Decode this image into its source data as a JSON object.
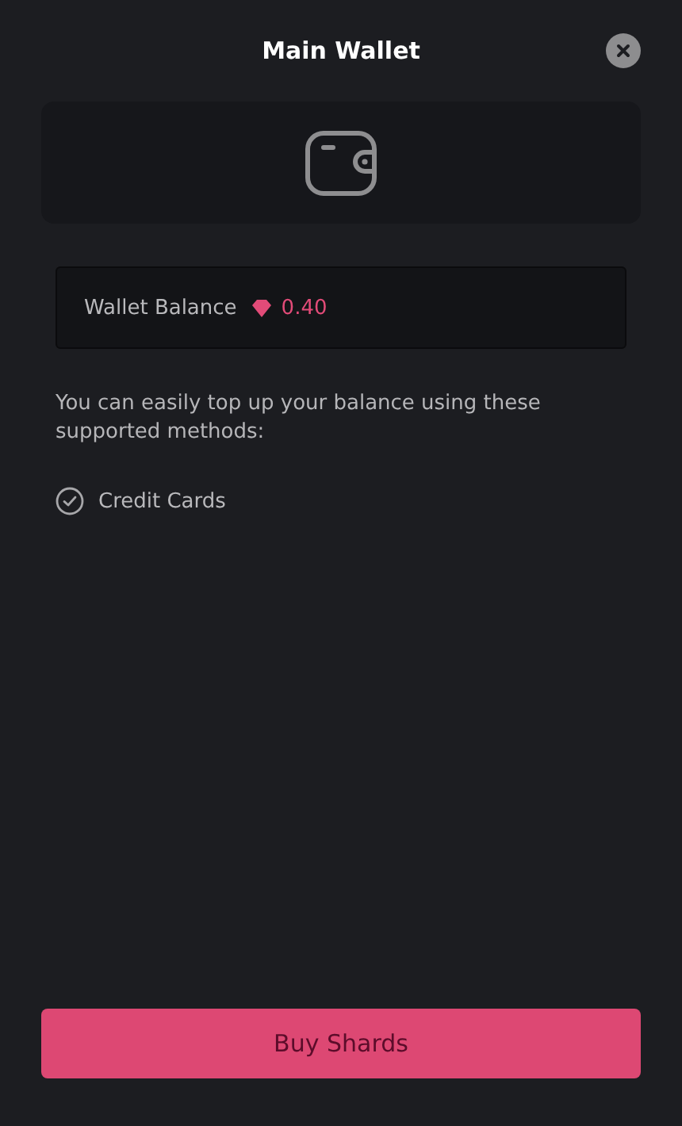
{
  "dialog": {
    "title": "Main Wallet"
  },
  "balance": {
    "label": "Wallet Balance",
    "amount": "0.40"
  },
  "description": "You can easily top up your balance using these supported methods:",
  "methods": [
    {
      "label": "Credit Cards"
    }
  ],
  "primary_button": "Buy Shards"
}
